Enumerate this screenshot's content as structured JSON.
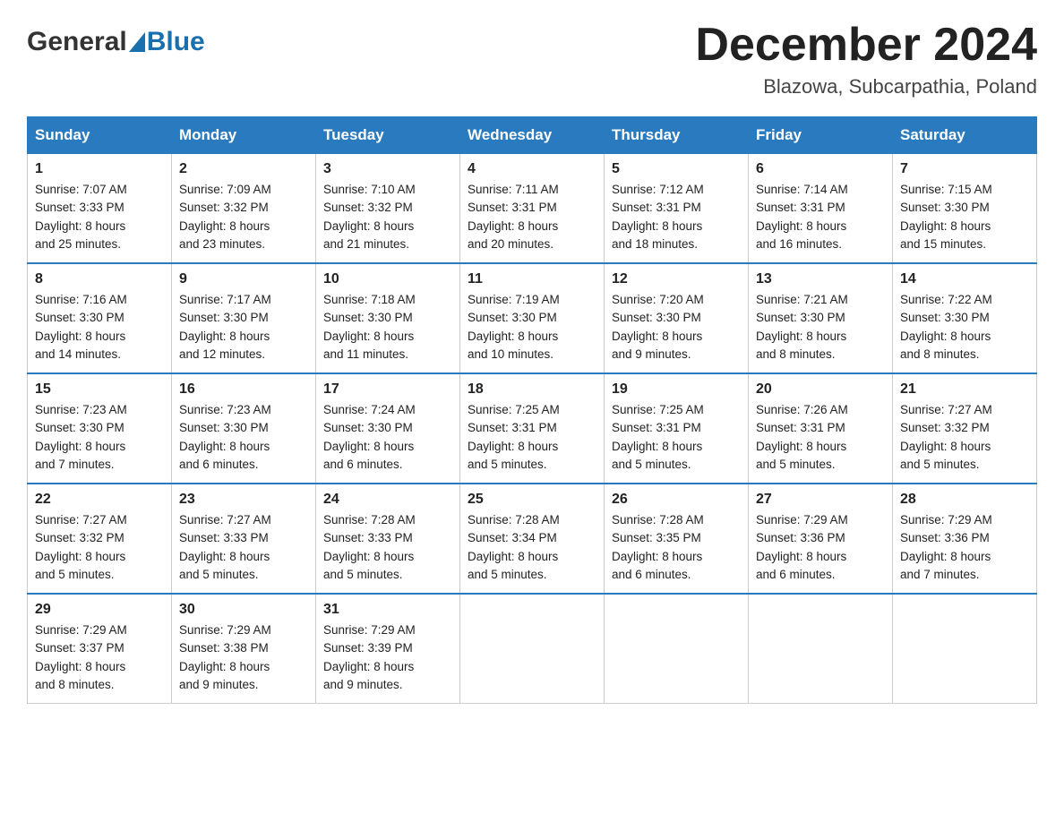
{
  "header": {
    "logo_general": "General",
    "logo_blue": "Blue",
    "month_title": "December 2024",
    "location": "Blazowa, Subcarpathia, Poland"
  },
  "days_of_week": [
    "Sunday",
    "Monday",
    "Tuesday",
    "Wednesday",
    "Thursday",
    "Friday",
    "Saturday"
  ],
  "weeks": [
    [
      {
        "day": "1",
        "sunrise": "7:07 AM",
        "sunset": "3:33 PM",
        "daylight": "8 hours and 25 minutes."
      },
      {
        "day": "2",
        "sunrise": "7:09 AM",
        "sunset": "3:32 PM",
        "daylight": "8 hours and 23 minutes."
      },
      {
        "day": "3",
        "sunrise": "7:10 AM",
        "sunset": "3:32 PM",
        "daylight": "8 hours and 21 minutes."
      },
      {
        "day": "4",
        "sunrise": "7:11 AM",
        "sunset": "3:31 PM",
        "daylight": "8 hours and 20 minutes."
      },
      {
        "day": "5",
        "sunrise": "7:12 AM",
        "sunset": "3:31 PM",
        "daylight": "8 hours and 18 minutes."
      },
      {
        "day": "6",
        "sunrise": "7:14 AM",
        "sunset": "3:31 PM",
        "daylight": "8 hours and 16 minutes."
      },
      {
        "day": "7",
        "sunrise": "7:15 AM",
        "sunset": "3:30 PM",
        "daylight": "8 hours and 15 minutes."
      }
    ],
    [
      {
        "day": "8",
        "sunrise": "7:16 AM",
        "sunset": "3:30 PM",
        "daylight": "8 hours and 14 minutes."
      },
      {
        "day": "9",
        "sunrise": "7:17 AM",
        "sunset": "3:30 PM",
        "daylight": "8 hours and 12 minutes."
      },
      {
        "day": "10",
        "sunrise": "7:18 AM",
        "sunset": "3:30 PM",
        "daylight": "8 hours and 11 minutes."
      },
      {
        "day": "11",
        "sunrise": "7:19 AM",
        "sunset": "3:30 PM",
        "daylight": "8 hours and 10 minutes."
      },
      {
        "day": "12",
        "sunrise": "7:20 AM",
        "sunset": "3:30 PM",
        "daylight": "8 hours and 9 minutes."
      },
      {
        "day": "13",
        "sunrise": "7:21 AM",
        "sunset": "3:30 PM",
        "daylight": "8 hours and 8 minutes."
      },
      {
        "day": "14",
        "sunrise": "7:22 AM",
        "sunset": "3:30 PM",
        "daylight": "8 hours and 8 minutes."
      }
    ],
    [
      {
        "day": "15",
        "sunrise": "7:23 AM",
        "sunset": "3:30 PM",
        "daylight": "8 hours and 7 minutes."
      },
      {
        "day": "16",
        "sunrise": "7:23 AM",
        "sunset": "3:30 PM",
        "daylight": "8 hours and 6 minutes."
      },
      {
        "day": "17",
        "sunrise": "7:24 AM",
        "sunset": "3:30 PM",
        "daylight": "8 hours and 6 minutes."
      },
      {
        "day": "18",
        "sunrise": "7:25 AM",
        "sunset": "3:31 PM",
        "daylight": "8 hours and 5 minutes."
      },
      {
        "day": "19",
        "sunrise": "7:25 AM",
        "sunset": "3:31 PM",
        "daylight": "8 hours and 5 minutes."
      },
      {
        "day": "20",
        "sunrise": "7:26 AM",
        "sunset": "3:31 PM",
        "daylight": "8 hours and 5 minutes."
      },
      {
        "day": "21",
        "sunrise": "7:27 AM",
        "sunset": "3:32 PM",
        "daylight": "8 hours and 5 minutes."
      }
    ],
    [
      {
        "day": "22",
        "sunrise": "7:27 AM",
        "sunset": "3:32 PM",
        "daylight": "8 hours and 5 minutes."
      },
      {
        "day": "23",
        "sunrise": "7:27 AM",
        "sunset": "3:33 PM",
        "daylight": "8 hours and 5 minutes."
      },
      {
        "day": "24",
        "sunrise": "7:28 AM",
        "sunset": "3:33 PM",
        "daylight": "8 hours and 5 minutes."
      },
      {
        "day": "25",
        "sunrise": "7:28 AM",
        "sunset": "3:34 PM",
        "daylight": "8 hours and 5 minutes."
      },
      {
        "day": "26",
        "sunrise": "7:28 AM",
        "sunset": "3:35 PM",
        "daylight": "8 hours and 6 minutes."
      },
      {
        "day": "27",
        "sunrise": "7:29 AM",
        "sunset": "3:36 PM",
        "daylight": "8 hours and 6 minutes."
      },
      {
        "day": "28",
        "sunrise": "7:29 AM",
        "sunset": "3:36 PM",
        "daylight": "8 hours and 7 minutes."
      }
    ],
    [
      {
        "day": "29",
        "sunrise": "7:29 AM",
        "sunset": "3:37 PM",
        "daylight": "8 hours and 8 minutes."
      },
      {
        "day": "30",
        "sunrise": "7:29 AM",
        "sunset": "3:38 PM",
        "daylight": "8 hours and 9 minutes."
      },
      {
        "day": "31",
        "sunrise": "7:29 AM",
        "sunset": "3:39 PM",
        "daylight": "8 hours and 9 minutes."
      },
      null,
      null,
      null,
      null
    ]
  ],
  "labels": {
    "sunrise": "Sunrise:",
    "sunset": "Sunset:",
    "daylight": "Daylight:"
  }
}
